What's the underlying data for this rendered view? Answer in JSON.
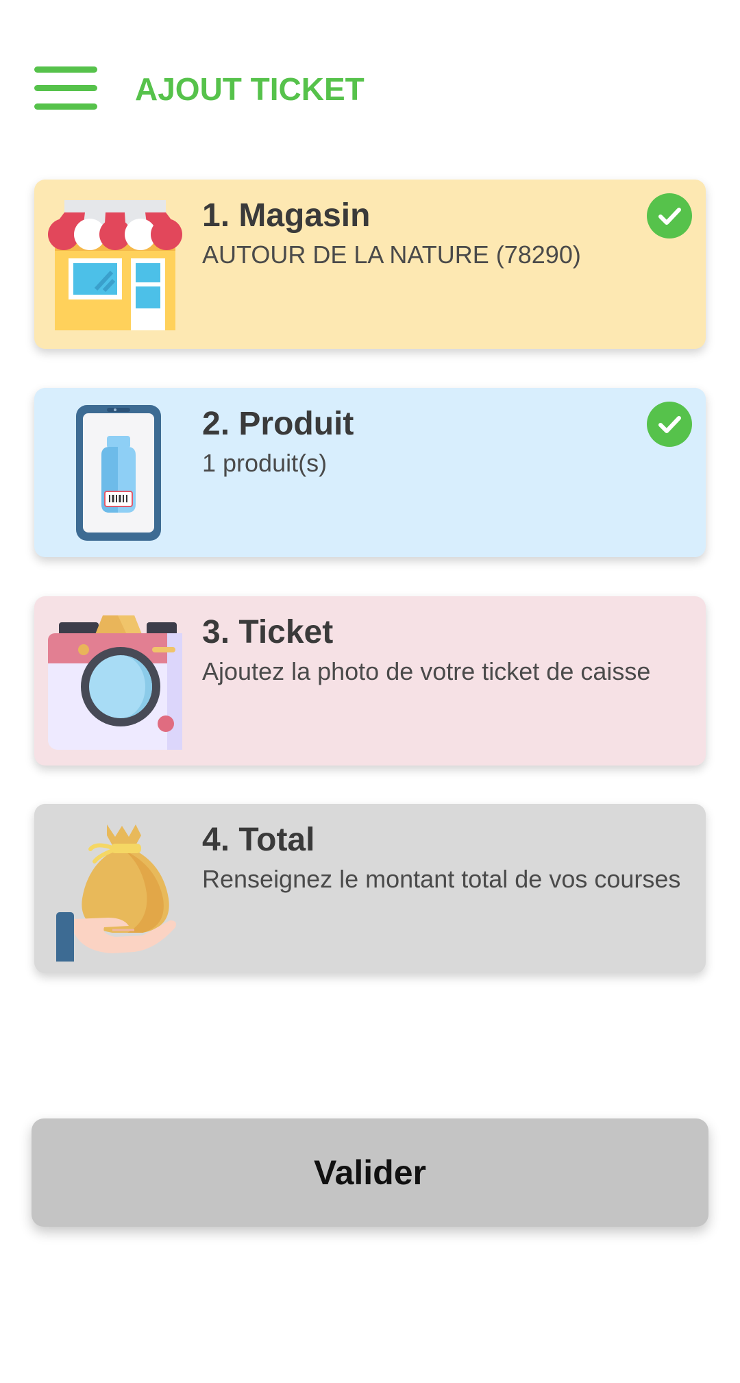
{
  "header": {
    "title": "AJOUT TICKET",
    "menu_icon": "hamburger-menu-icon"
  },
  "colors": {
    "accent": "#56c24b",
    "card_store": "#fde8b2",
    "card_product": "#d8eefd",
    "card_ticket": "#f6e1e5",
    "card_total": "#d9d9d9",
    "button": "#c4c4c4"
  },
  "steps": [
    {
      "title": "1. Magasin",
      "description": "AUTOUR DE LA NATURE (78290)",
      "icon": "store-icon",
      "completed": true
    },
    {
      "title": "2. Produit",
      "description": "1 produit(s)",
      "icon": "phone-product-icon",
      "completed": true
    },
    {
      "title": "3. Ticket",
      "description": "Ajoutez la photo de votre ticket de caisse",
      "icon": "camera-icon",
      "completed": false
    },
    {
      "title": "4. Total",
      "description": "Renseignez le montant total de vos courses",
      "icon": "money-bag-icon",
      "completed": false
    }
  ],
  "actions": {
    "validate_label": "Valider"
  }
}
